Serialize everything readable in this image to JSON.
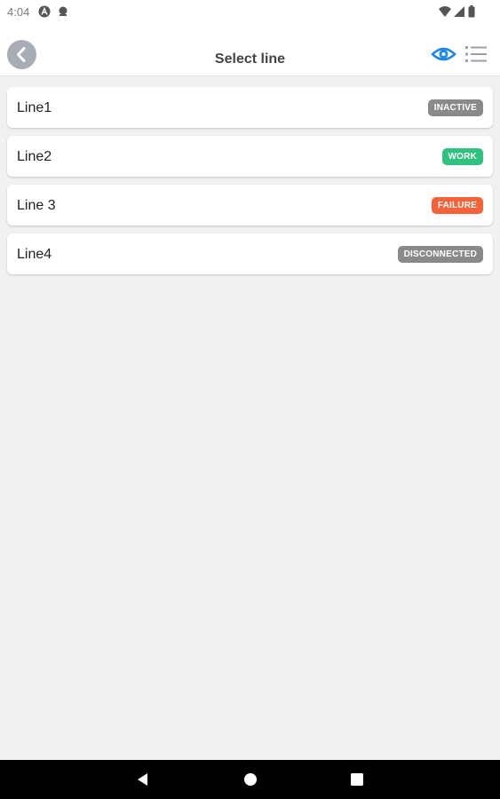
{
  "status_bar": {
    "time": "4:04",
    "icons": [
      "a-icon",
      "notification-icon",
      "wifi-icon",
      "signal-icon",
      "battery-icon"
    ]
  },
  "app_bar": {
    "title": "Select line",
    "back_icon": "chevron-left-icon",
    "actions": [
      "eye-icon",
      "list-icon"
    ],
    "accent_color": "#1e88e5"
  },
  "lines": [
    {
      "name": "Line1",
      "status": "INACTIVE",
      "status_color": "#8a8a8a"
    },
    {
      "name": "Line2",
      "status": "WORK",
      "status_color": "#2ec27e"
    },
    {
      "name": "Line 3",
      "status": "FAILURE",
      "status_color": "#f4623a"
    },
    {
      "name": "Line4",
      "status": "DISCONNECTED",
      "status_color": "#8a8a8a"
    }
  ],
  "nav_bar": {
    "buttons": [
      "back-triangle-icon",
      "home-circle-icon",
      "recents-square-icon"
    ]
  }
}
